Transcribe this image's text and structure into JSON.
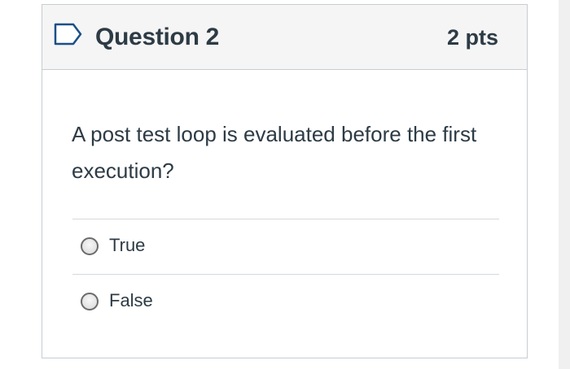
{
  "question": {
    "flag_icon": "bookmark-flag-icon",
    "title": "Question 2",
    "points": "2 pts",
    "text": "A post test loop is evaluated before the first execution?",
    "answers": [
      {
        "label": "True",
        "selected": false
      },
      {
        "label": "False",
        "selected": false
      }
    ]
  },
  "colors": {
    "header_bg": "#f5f5f5",
    "border": "#c7cdd1",
    "text": "#2d3b45",
    "flag_stroke": "#1c4f86"
  }
}
